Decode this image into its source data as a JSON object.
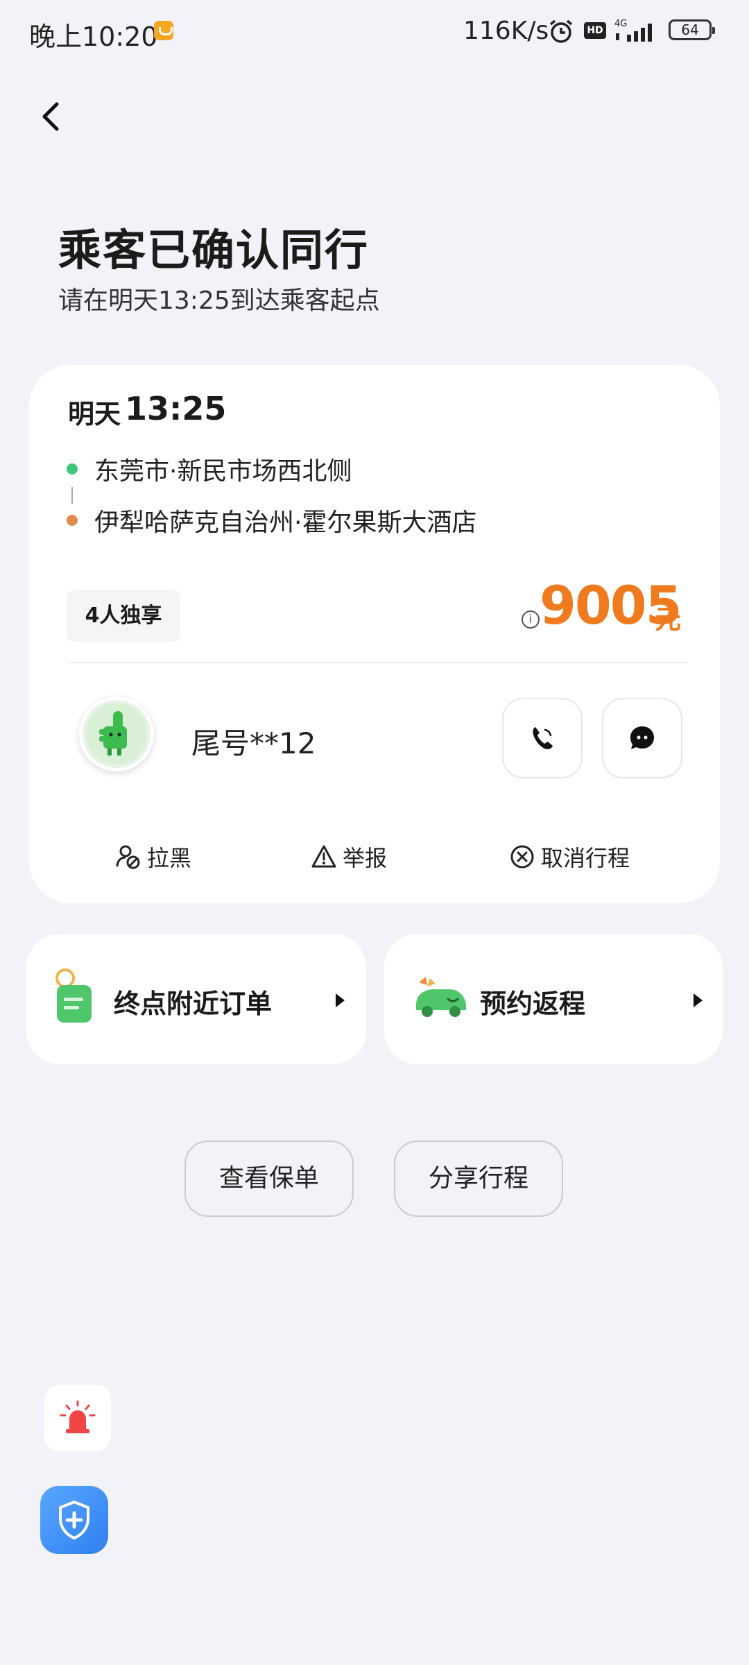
{
  "status_bar": {
    "time": "晚上10:20",
    "network_speed": "116K/s",
    "hd": "HD",
    "signal_type": "4G",
    "battery": "64"
  },
  "header": {
    "title": "乘客已确认同行",
    "subtitle": "请在明天13:25到达乘客起点"
  },
  "trip": {
    "date": "明天",
    "time": "13:25",
    "start": "东莞市·新民市场西北侧",
    "end": "伊犁哈萨克自治州·霍尔果斯大酒店",
    "seat_tag": "4人独享",
    "price": "9005",
    "price_unit": "元",
    "info_icon": "i",
    "passenger_name": "尾号**12",
    "actions": {
      "block": "拉黑",
      "report": "举报",
      "cancel": "取消行程"
    }
  },
  "features": {
    "nearby_orders": "终点附近订单",
    "return_trip": "预约返程"
  },
  "buttons": {
    "view_policy": "查看保单",
    "share_trip": "分享行程"
  },
  "colors": {
    "accent_orange": "#f07a1e",
    "start_dot": "#3ec77a",
    "end_dot": "#e08a4c",
    "safety_blue": "#2f7ff0"
  }
}
